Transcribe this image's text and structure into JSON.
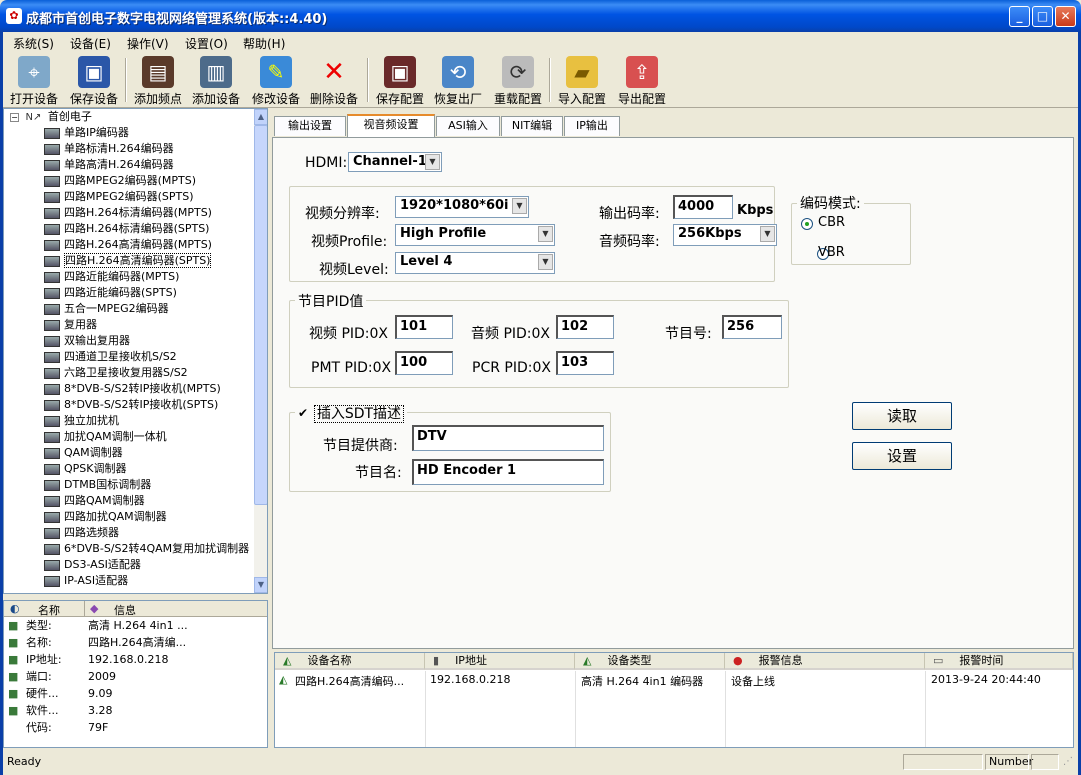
{
  "window": {
    "title": "成都市首创电子数字电视网络管理系统(版本::4.40)"
  },
  "menu": [
    "系统(S)",
    "设备(E)",
    "操作(V)",
    "设置(O)",
    "帮助(H)"
  ],
  "toolbar": {
    "groups": [
      [
        {
          "label": "打开设备",
          "icon": "satellite-icon"
        },
        {
          "label": "保存设备",
          "icon": "floppy-icon"
        }
      ],
      [
        {
          "label": "添加频点",
          "icon": "film-icon"
        },
        {
          "label": "添加设备",
          "icon": "device-icon"
        },
        {
          "label": "修改设备",
          "icon": "edit-icon"
        },
        {
          "label": "删除设备",
          "icon": "delete-x-icon"
        }
      ],
      [
        {
          "label": "保存配置",
          "icon": "save-config-icon"
        },
        {
          "label": "恢复出厂",
          "icon": "restore-icon"
        },
        {
          "label": "重载配置",
          "icon": "reload-icon"
        }
      ],
      [
        {
          "label": "导入配置",
          "icon": "import-folder-icon"
        },
        {
          "label": "导出配置",
          "icon": "export-icon"
        }
      ]
    ]
  },
  "tree": {
    "root": "首创电子",
    "items": [
      "单路IP编码器",
      "单路标清H.264编码器",
      "单路高清H.264编码器",
      "四路MPEG2编码器(MPTS)",
      "四路MPEG2编码器(SPTS)",
      "四路H.264标清编码器(MPTS)",
      "四路H.264标清编码器(SPTS)",
      "四路H.264高清编码器(MPTS)",
      "四路H.264高清编码器(SPTS)",
      "四路近能编码器(MPTS)",
      "四路近能编码器(SPTS)",
      "五合一MPEG2编码器",
      "复用器",
      "双输出复用器",
      "四通道卫星接收机S/S2",
      "六路卫星接收复用器S/S2",
      "8*DVB-S/S2转IP接收机(MPTS)",
      "8*DVB-S/S2转IP接收机(SPTS)",
      "独立加扰机",
      "加扰QAM调制一体机",
      "QAM调制器",
      "QPSK调制器",
      "DTMB国标调制器",
      "四路QAM调制器",
      "四路加扰QAM调制器",
      "四路选频器",
      "6*DVB-S/S2转4QAM复用加扰调制器",
      "DS3-ASI适配器",
      "IP-ASI适配器"
    ],
    "selected_index": 8
  },
  "info": {
    "headers": [
      "名称",
      "信息"
    ],
    "rows": [
      {
        "name": "类型:",
        "value": "高清 H.264 4in1 ...",
        "icon": "type-icon"
      },
      {
        "name": "名称:",
        "value": "四路H.264高清编...",
        "icon": "name-icon"
      },
      {
        "name": "IP地址:",
        "value": "192.168.0.218",
        "icon": "ip-icon"
      },
      {
        "name": "端口:",
        "value": "2009",
        "icon": "port-icon"
      },
      {
        "name": "硬件...",
        "value": "9.09",
        "icon": "hardware-icon"
      },
      {
        "name": "软件...",
        "value": "3.28",
        "icon": "software-icon"
      },
      {
        "name": "代码:",
        "value": "79F",
        "icon": ""
      }
    ]
  },
  "tabs": [
    "输出设置",
    "视音频设置",
    "ASI输入",
    "NIT编辑",
    "IP输出"
  ],
  "active_tab": 1,
  "form": {
    "hdmi_label": "HDMI:",
    "hdmi_value": "Channel-1",
    "res_label": "视频分辨率:",
    "res_value": "1920*1080*60i",
    "profile_label": "视频Profile:",
    "profile_value": "High Profile",
    "level_label": "视频Level:",
    "level_value": "Level 4",
    "bitrate_label": "输出码率:",
    "bitrate_value": "4000",
    "bitrate_unit": "Kbps",
    "audio_label": "音频码率:",
    "audio_value": "256Kbps",
    "mode_title": "编码模式:",
    "mode_cbr": "CBR",
    "mode_vbr": "VBR",
    "mode_selected": "CBR",
    "pid_title": "节目PID值",
    "video_pid_label": "视频 PID:0X",
    "video_pid": "101",
    "audio_pid_label": "音频 PID:0X",
    "audio_pid": "102",
    "prog_num_label": "节目号:",
    "prog_num": "256",
    "pmt_pid_label": "PMT PID:0X",
    "pmt_pid": "100",
    "pcr_pid_label": "PCR PID:0X",
    "pcr_pid": "103",
    "sdt_label": "插入SDT描述",
    "sdt_checked": true,
    "provider_label": "节目提供商:",
    "provider_value": "DTV",
    "name_label": "节目名:",
    "name_value": "HD Encoder 1",
    "read_btn": "读取",
    "set_btn": "设置"
  },
  "list": {
    "headers": [
      "设备名称",
      "IP地址",
      "设备类型",
      "报警信息",
      "报警时间"
    ],
    "rows": [
      {
        "name": "四路H.264高清编码...",
        "ip": "192.168.0.218",
        "type": "高清 H.264 4in1 编码器",
        "alarm": "设备上线",
        "time": "2013-9-24 20:44:40"
      }
    ]
  },
  "status": {
    "text": "Ready",
    "number": "Number"
  }
}
